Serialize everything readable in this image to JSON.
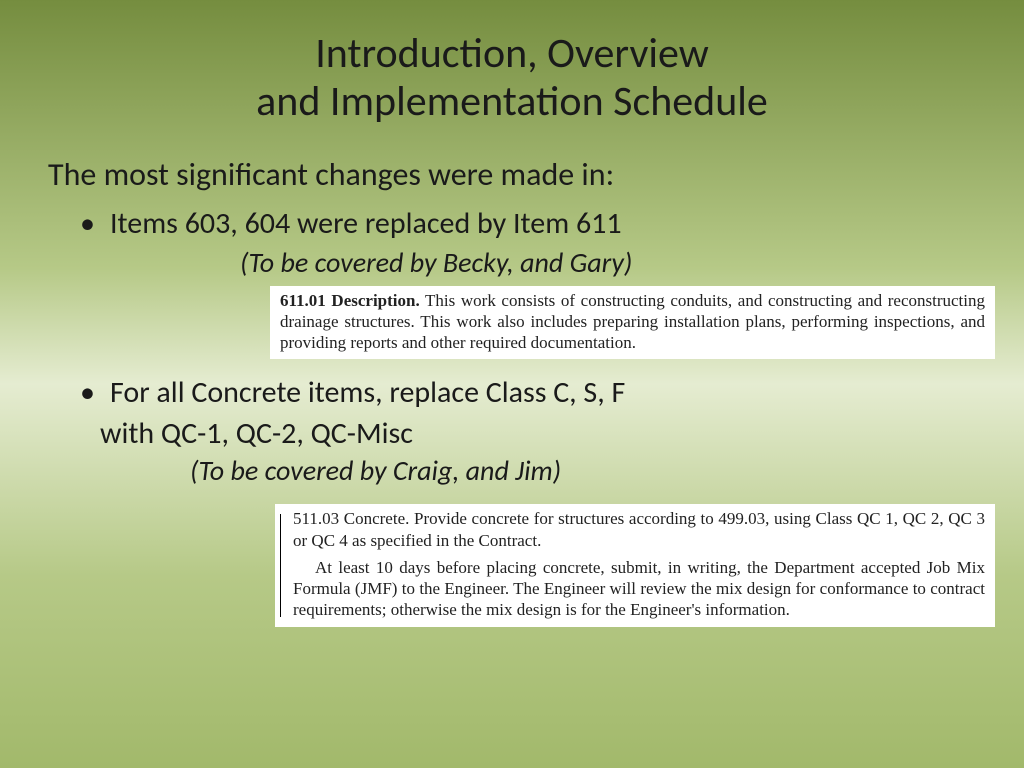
{
  "title_line1": "Introduction, Overview",
  "title_line2": "and Implementation Schedule",
  "intro": "The most significant changes were made in:",
  "bullet1": "Items 603, 604 were replaced by Item 611",
  "covered1": "(To be covered by Becky, and Gary)",
  "spec1_head": "611.01 Description.",
  "spec1_body": " This work consists of constructing conduits, and constructing and reconstructing drainage structures.  This work also includes preparing installation plans, performing inspections, and providing reports and other required documentation.",
  "bullet2a": "For all Concrete items, replace Class C, S, F",
  "bullet2b": "with QC-1, QC-2, QC-Misc",
  "covered2": "(To be covered by Craig, and Jim)",
  "spec2_head": "511.03  Concrete.",
  "spec2_p1": "  Provide concrete for structures according to 499.03, using Class QC 1, QC 2, QC 3 or QC 4 as specified in the Contract.",
  "spec2_p2": "At least 10 days before placing concrete, submit, in writing, the Department accepted Job Mix Formula (JMF) to the Engineer.  The Engineer will review the mix design for conformance to contract requirements; otherwise the mix design is for the Engineer's information."
}
